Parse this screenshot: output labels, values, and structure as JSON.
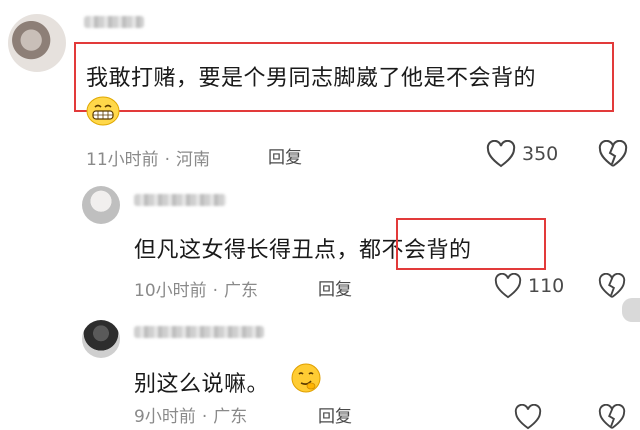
{
  "comments": [
    {
      "text": "我敢打赌，要是个男同志脚崴了他是不会背的",
      "time": "11小时前",
      "location": "河南",
      "reply_label": "回复",
      "likes": "350"
    },
    {
      "text_prefix": "但凡这女得长得丑点，",
      "text_highlight": "都不会背的",
      "time": "10小时前",
      "location": "广东",
      "reply_label": "回复",
      "likes": "110"
    },
    {
      "text": "别这么说嘛。",
      "time": "9小时前",
      "location": "广东",
      "reply_label": "回复"
    }
  ],
  "colors": {
    "highlight_box": "#e23a3a",
    "meta": "#8a8a8a"
  },
  "icons": [
    "heart-icon",
    "broken-heart-icon",
    "grinning-emoji",
    "smirk-emoji"
  ]
}
